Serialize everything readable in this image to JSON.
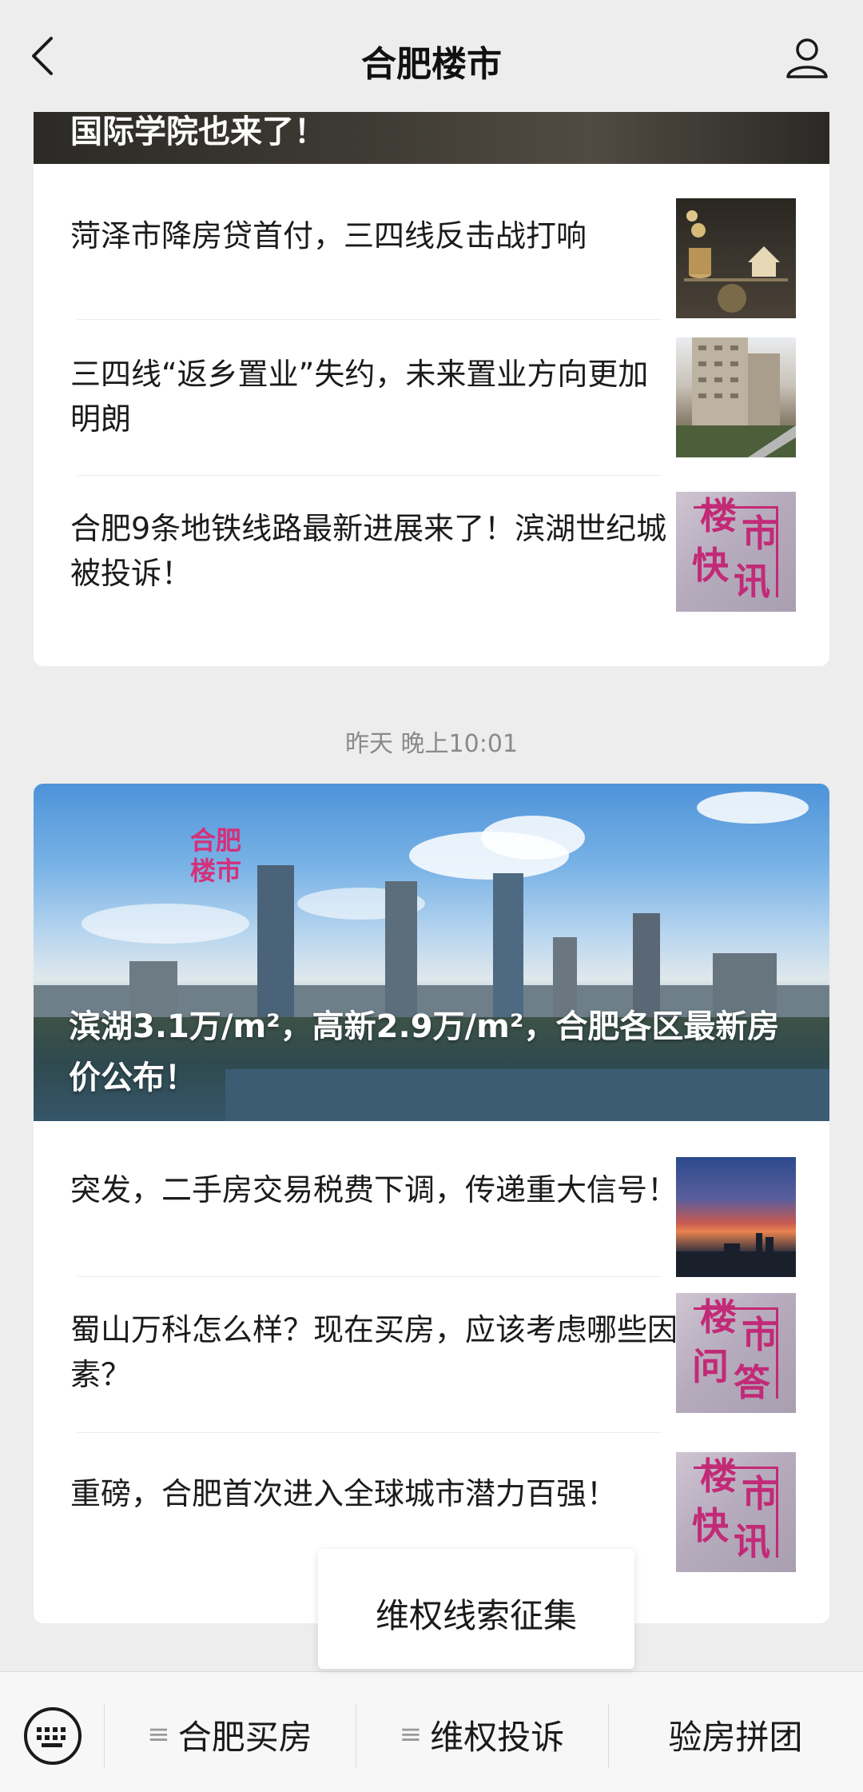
{
  "header": {
    "title": "合肥楼市",
    "back_icon": "chevron-left-icon",
    "user_icon": "person-icon"
  },
  "feed": {
    "card1": {
      "cover_title": "国际学院也来了！",
      "items": [
        {
          "text": "菏泽市降房贷首付，三四线反击战打响",
          "thumb": "money"
        },
        {
          "text": "三四线“返乡置业”失约，未来置业方向更加明朗",
          "thumb": "housing"
        },
        {
          "text": "合肥9条地铁线路最新进展来了！滨湖世纪城被投诉！",
          "thumb": "kuaixun",
          "stamp": [
            "楼",
            "市",
            "快",
            "讯"
          ]
        }
      ]
    },
    "time": "昨天 晚上10:01",
    "card2": {
      "logo": [
        "合肥",
        "楼市"
      ],
      "cover_title": "滨湖3.1万/m²，高新2.9万/m²，合肥各区最新房价公布！",
      "items": [
        {
          "text": "突发，二手房交易税费下调，传递重大信号！",
          "thumb": "sunset"
        },
        {
          "text": "蜀山万科怎么样？现在买房，应该考虑哪些因素？",
          "thumb": "wenda",
          "stamp": [
            "楼",
            "市",
            "问",
            "答"
          ]
        },
        {
          "text": "重磅，合肥首次进入全球城市潜力百强！",
          "thumb": "kuaixun",
          "stamp": [
            "楼",
            "市",
            "快",
            "讯"
          ]
        }
      ]
    }
  },
  "popup": {
    "label": "维权线索征集"
  },
  "menu": {
    "keyboard_icon": "keyboard-icon",
    "items": [
      "合肥买房",
      "维权投诉",
      "验房拼团"
    ]
  },
  "colors": {
    "accent": "#c22a77",
    "background": "#ededed"
  }
}
